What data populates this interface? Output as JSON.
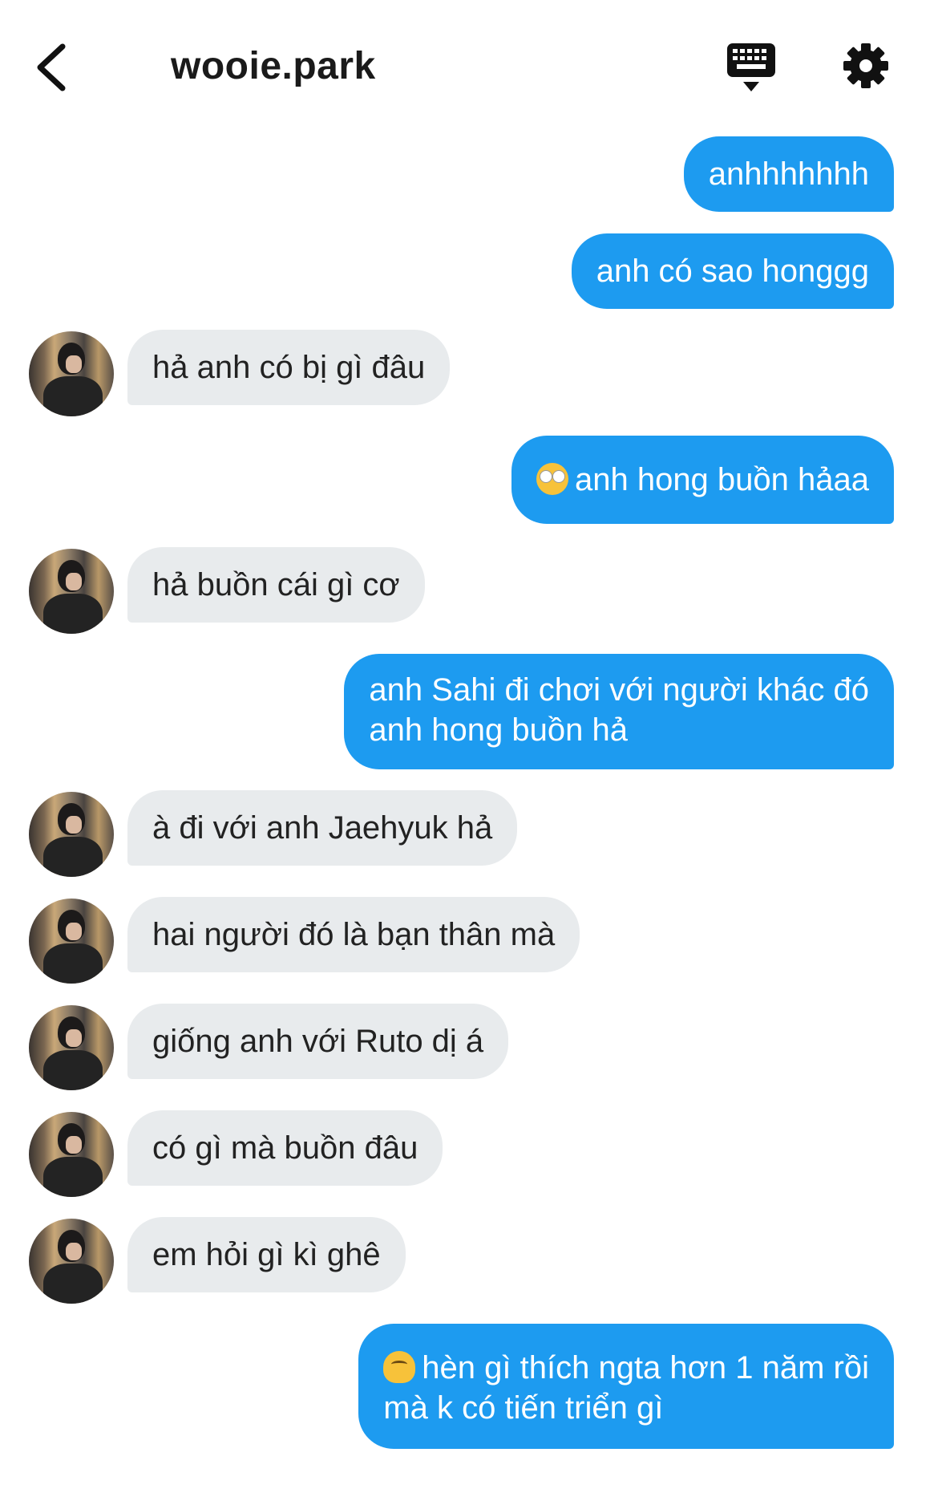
{
  "header": {
    "title": "wooie.park"
  },
  "messages": [
    {
      "id": "m1",
      "side": "out",
      "text": "anhhhhhhh"
    },
    {
      "id": "m2",
      "side": "out",
      "text": "anh có sao honggg"
    },
    {
      "id": "m3",
      "side": "in",
      "text": "hả anh có bị gì đâu"
    },
    {
      "id": "m4",
      "side": "out",
      "emoji": "face-with-rolling-eyes",
      "text": "anh hong buồn hảaa"
    },
    {
      "id": "m5",
      "side": "in",
      "text": "hả buồn cái gì cơ"
    },
    {
      "id": "m6",
      "side": "out",
      "lines": [
        "anh Sahi đi chơi với người khác đó",
        "anh hong buồn hả"
      ]
    },
    {
      "id": "m7",
      "side": "in",
      "text": "à đi với anh Jaehyuk hả"
    },
    {
      "id": "m8",
      "side": "in",
      "text": "hai người đó là bạn thân mà"
    },
    {
      "id": "m9",
      "side": "in",
      "text": "giống anh với Ruto dị á"
    },
    {
      "id": "m10",
      "side": "in",
      "text": "có gì mà buồn đâu"
    },
    {
      "id": "m11",
      "side": "in",
      "text": "em hỏi gì kì ghê"
    },
    {
      "id": "m12",
      "side": "out",
      "emoji": "melting-face",
      "lines": [
        "hèn gì thích ngta hơn 1 năm rồi",
        "mà k có tiến triển gì"
      ]
    }
  ],
  "colors": {
    "outgoing_bubble": "#1d9bf0",
    "incoming_bubble": "#e8ebed",
    "background": "#ffffff"
  },
  "icons": [
    "back-arrow-icon",
    "keyboard-icon",
    "gear-icon"
  ]
}
